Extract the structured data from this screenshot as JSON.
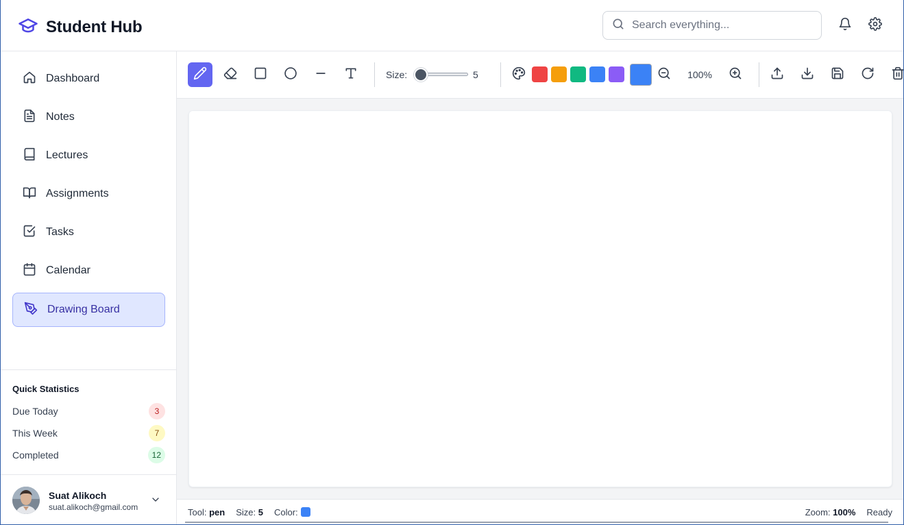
{
  "header": {
    "app_title": "Student Hub",
    "search_placeholder": "Search everything...",
    "icons": [
      "graduation-cap-icon",
      "search-icon",
      "bell-icon",
      "gear-icon"
    ]
  },
  "sidebar": {
    "items": [
      {
        "label": "Dashboard",
        "icon": "home-icon",
        "active": false
      },
      {
        "label": "Notes",
        "icon": "file-text-icon",
        "active": false
      },
      {
        "label": "Lectures",
        "icon": "book-icon",
        "active": false
      },
      {
        "label": "Assignments",
        "icon": "book-open-icon",
        "active": false
      },
      {
        "label": "Tasks",
        "icon": "check-square-icon",
        "active": false
      },
      {
        "label": "Calendar",
        "icon": "calendar-icon",
        "active": false
      },
      {
        "label": "Drawing Board",
        "icon": "pen-tool-icon",
        "active": true
      }
    ],
    "quick_stats": {
      "title": "Quick Statistics",
      "rows": [
        {
          "label": "Due Today",
          "value": "3",
          "bg": "#fee2e2",
          "fg": "#b91c1c"
        },
        {
          "label": "This Week",
          "value": "7",
          "bg": "#fef9c3",
          "fg": "#854d0e"
        },
        {
          "label": "Completed",
          "value": "12",
          "bg": "#dcfce7",
          "fg": "#166534"
        }
      ]
    },
    "user": {
      "name": "Suat Alikoch",
      "email": "suat.alikoch@gmail.com"
    }
  },
  "toolbar": {
    "tools": [
      "pen",
      "eraser",
      "rectangle",
      "circle",
      "line",
      "text"
    ],
    "active_tool": "pen",
    "size_label": "Size:",
    "size_value": "5",
    "palette": [
      "#ef4444",
      "#f59e0b",
      "#10b981",
      "#3b82f6",
      "#8b5cf6"
    ],
    "current_color": "#3b82f6",
    "zoom_value": "100%",
    "actions": [
      "upload-icon",
      "download-icon",
      "save-icon",
      "refresh-icon",
      "trash-icon"
    ]
  },
  "status": {
    "tool_label": "Tool:",
    "tool_value": "pen",
    "size_label": "Size:",
    "size_value": "5",
    "color_label": "Color:",
    "color_value": "#3b82f6",
    "zoom_label": "Zoom:",
    "zoom_value": "100%",
    "state": "Ready"
  },
  "colors": {
    "accent": "#6366f1",
    "active_nav_bg": "#e0e7ff",
    "active_nav_text": "#3730a3"
  }
}
